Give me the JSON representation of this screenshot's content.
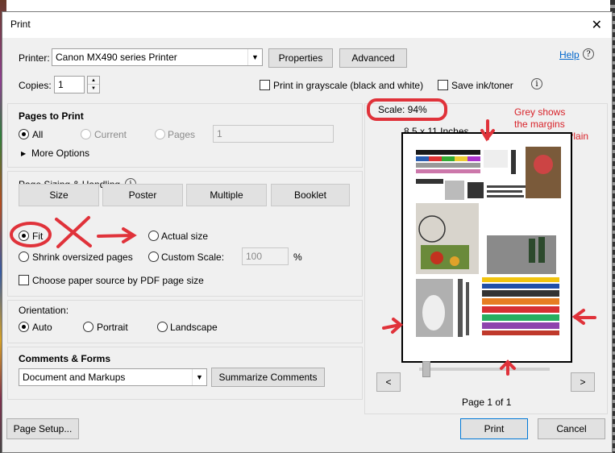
{
  "window": {
    "title": "Print",
    "close": "✕"
  },
  "printer": {
    "label": "Printer:",
    "selected": "Canon MX490 series Printer",
    "properties_label": "Properties",
    "advanced_label": "Advanced",
    "help_label": "Help",
    "help_icon": "?"
  },
  "copies": {
    "label": "Copies:",
    "value": "1"
  },
  "options": {
    "grayscale_label": "Print in grayscale (black and white)",
    "save_ink_label": "Save ink/toner",
    "info_icon": "i"
  },
  "pages_to_print": {
    "title": "Pages to Print",
    "all_label": "All",
    "current_label": "Current",
    "pages_label": "Pages",
    "pages_value": "1",
    "more_options_label": "More Options",
    "more_arrow": "▶"
  },
  "sizing": {
    "title": "Page Sizing & Handling",
    "info_icon": "i",
    "tabs": [
      "Size",
      "Poster",
      "Multiple",
      "Booklet"
    ],
    "fit_label": "Fit",
    "actual_size_label": "Actual size",
    "shrink_label": "Shrink oversized pages",
    "custom_scale_label": "Custom Scale:",
    "custom_scale_value": "100",
    "percent": "%",
    "paper_source_label": "Choose paper source by PDF page size"
  },
  "orientation": {
    "title": "Orientation:",
    "auto_label": "Auto",
    "portrait_label": "Portrait",
    "landscape_label": "Landscape"
  },
  "comments": {
    "title": "Comments & Forms",
    "selected": "Document and Markups",
    "summarize_label": "Summarize Comments"
  },
  "preview": {
    "scale_text": "Scale:  94%",
    "paper_size": "8.5 x 11 Inches",
    "annotation": [
      "Grey shows",
      "the margins",
      "of Standard Plain"
    ],
    "prev_label": "<",
    "next_label": ">",
    "page_indicator": "Page 1 of 1"
  },
  "footer": {
    "page_setup_label": "Page Setup...",
    "print_label": "Print",
    "cancel_label": "Cancel"
  },
  "colors": {
    "annotation_red": "#d8232a",
    "dialog_bg": "#f0f0f0",
    "button_bg": "#e1e1e1",
    "help_link": "#0066cc"
  }
}
